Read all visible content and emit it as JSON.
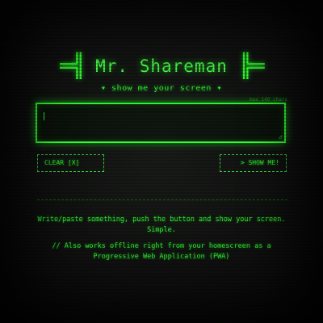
{
  "header": {
    "title": "Mr. Shareman",
    "left_bracket": "═╣",
    "right_bracket": "╠═",
    "subtitle": "▾ show me your screen ▾"
  },
  "input": {
    "max_label": "max 140 chars",
    "value": "",
    "resize_glyph": "◿"
  },
  "buttons": {
    "clear_label": "CLEAR [X]",
    "show_label": "> SHOW ME!"
  },
  "description": {
    "line1": "Write/paste something, push the button and show your screen. Simple.",
    "line2": "// Also works offline right from your homescreen as a Progressive Web Application (PWA)"
  },
  "colors": {
    "accent": "#33ff33",
    "background": "#0b0c0b"
  }
}
